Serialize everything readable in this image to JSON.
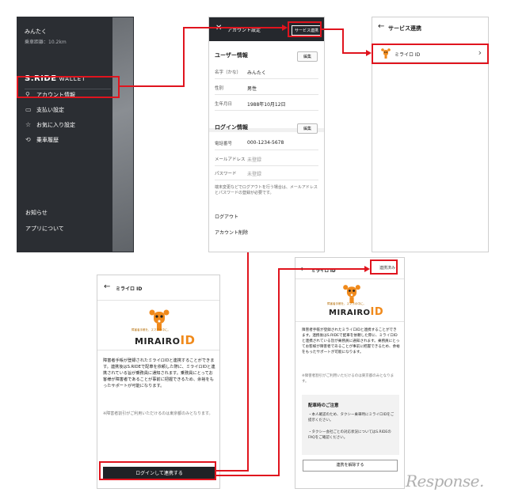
{
  "drawer": {
    "user_name": "みんたく",
    "distance": "乗車距離：10.2km",
    "logo_main": "S.RIDE",
    "logo_sub": "WALLET",
    "menu": [
      {
        "label": "アカウント情報",
        "icon": "person-icon"
      },
      {
        "label": "支払い設定",
        "icon": "card-icon"
      },
      {
        "label": "お気に入り設定",
        "icon": "star-icon"
      },
      {
        "label": "乗車履歴",
        "icon": "history-icon"
      }
    ],
    "notice": "お知らせ",
    "about": "アプリについて"
  },
  "account": {
    "title": "アカウント設定",
    "service_link_button": "サービス連携",
    "user_section": "ユーザー情報",
    "edit_label": "編集",
    "name_key": "名字（かな）",
    "name_val": "みんたく",
    "gender_key": "性別",
    "gender_val": "男性",
    "birth_key": "生年月日",
    "birth_val": "1988年10月12日",
    "login_section": "ログイン情報",
    "phone_key": "電話番号",
    "phone_val": "000-1234-5678",
    "mail_key": "メールアドレス",
    "mail_val": "未登録",
    "pass_key": "パスワード",
    "pass_val": "未登録",
    "note": "端末変更などでログアウトを行う場合は、メールアドレスとパスワードの登録が必要です。",
    "logout": "ログアウト",
    "delete": "アカウント削除"
  },
  "service": {
    "title": "サービス連携",
    "item": "ミライロ ID"
  },
  "mirairo_link": {
    "title": "ミライロ ID",
    "tagline": "障害者手帳を、スマホの中に。",
    "brand": "MIRAIRO",
    "brand_id": "ID",
    "desc": "障害者手帳が登録されたミライロIDと連携することができます。連携後はS.RIDEで配車を依頼した際に、ミライロIDと連携されている旨が乗務員に通知されます。乗務員にとってお客様が障害者であることが事前に把握できるため、余裕をもったサポートが可能になります。",
    "desc2": "※障害者割引がご利用いただけるのは東京都のみとなります。",
    "cta": "ログインして連携する"
  },
  "mirairo_linked": {
    "title": "ミライロ ID",
    "status": "連携済み",
    "tagline": "障害者手帳を、スマホの中に。",
    "brand": "MIRAIRO",
    "brand_id": "ID",
    "desc": "障害者手帳が登録されたミライロIDと連携することができます。連携後はS.RIDEで配車を依頼した際に、ミライロIDと連携されている旨が乗務員に通知されます。乗務員にとってお客様が障害者であることが事前に把握できるため、余裕をもったサポートが可能になります。",
    "desc2": "※障害者割引がご利用いただけるのは東京都のみとなります。",
    "notes_title": "配車時のご注意",
    "note1": "本人確認のため、タクシー乗車時にミライロIDをご提示ください。",
    "note2": "タクシー会社ごとの対応状況についてはS.RIDEのFAQをご確認ください。",
    "unlink": "連携を解除する"
  },
  "watermark": "Response."
}
